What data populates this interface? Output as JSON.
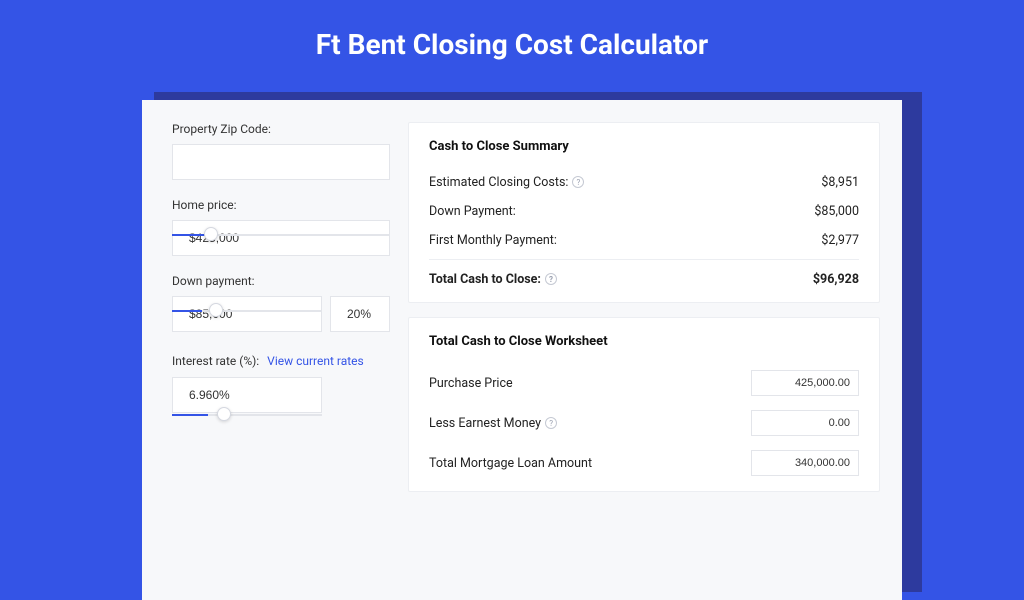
{
  "title": "Ft Bent Closing Cost Calculator",
  "form": {
    "zip": {
      "label": "Property Zip Code:",
      "value": ""
    },
    "home_price": {
      "label": "Home price:",
      "value": "$425,000",
      "slider_pct": 18
    },
    "down_payment": {
      "label": "Down payment:",
      "value": "$85,000",
      "pct_value": "20%",
      "slider_pct": 20
    },
    "interest": {
      "label": "Interest rate (%):",
      "link": "View current rates",
      "value": "6.960%",
      "slider_pct": 24
    }
  },
  "summary": {
    "heading": "Cash to Close Summary",
    "rows": [
      {
        "label": "Estimated Closing Costs:",
        "help": true,
        "value": "$8,951"
      },
      {
        "label": "Down Payment:",
        "help": false,
        "value": "$85,000"
      },
      {
        "label": "First Monthly Payment:",
        "help": false,
        "value": "$2,977"
      }
    ],
    "total": {
      "label": "Total Cash to Close:",
      "help": true,
      "value": "$96,928"
    }
  },
  "worksheet": {
    "heading": "Total Cash to Close Worksheet",
    "rows": [
      {
        "label": "Purchase Price",
        "help": false,
        "value": "425,000.00"
      },
      {
        "label": "Less Earnest Money",
        "help": true,
        "value": "0.00"
      },
      {
        "label": "Total Mortgage Loan Amount",
        "help": false,
        "value": "340,000.00"
      }
    ]
  }
}
